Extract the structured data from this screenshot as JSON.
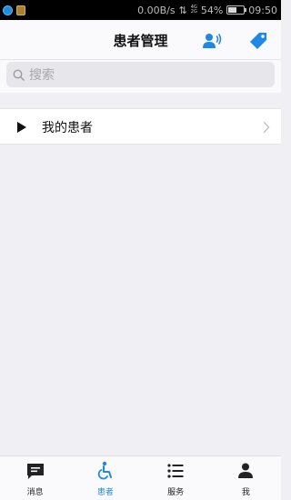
{
  "status_bar": {
    "net_speed": "0.00B/s",
    "signal": [
      "4G",
      "2G"
    ],
    "battery_percent": "54%",
    "battery_level": 0.54,
    "time": "09:50"
  },
  "header": {
    "title": "患者管理",
    "accent_color": "#1e88e5",
    "icons": [
      "voice-icon",
      "tag-icon"
    ]
  },
  "search": {
    "placeholder": "搜索"
  },
  "list": {
    "items": [
      {
        "label": "我的患者",
        "icon": "play-icon"
      }
    ]
  },
  "tabbar": {
    "tabs": [
      {
        "label": "消息",
        "icon": "chat-icon",
        "active": false
      },
      {
        "label": "患者",
        "icon": "wheelchair-icon",
        "active": true
      },
      {
        "label": "服务",
        "icon": "list-icon",
        "active": false
      },
      {
        "label": "我",
        "icon": "person-icon",
        "active": false
      }
    ]
  }
}
